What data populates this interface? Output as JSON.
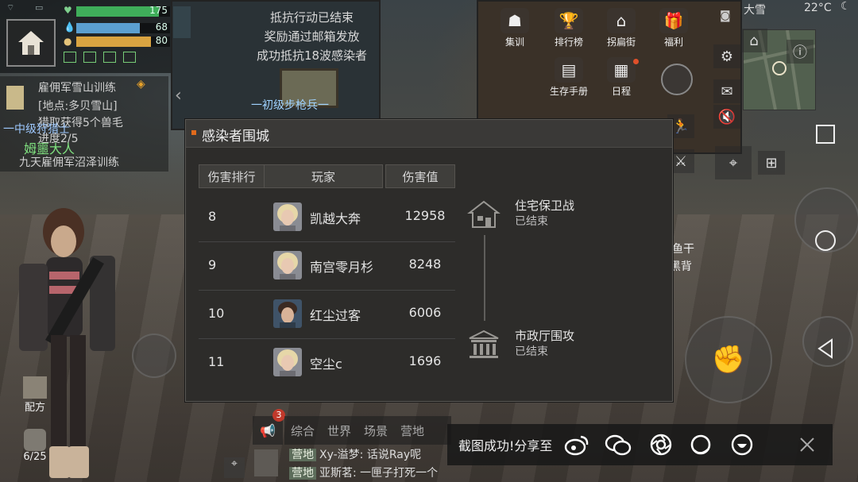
{
  "hud": {
    "hp_value": "175",
    "water_value": "68",
    "food_value": "80",
    "hp_fraction": 0.88,
    "water_fraction": 0.68,
    "food_fraction": 0.8
  },
  "quest": {
    "line1": "雇佣军雪山训练",
    "line2": "[地点:多贝雪山]",
    "line3": "猎取获得5个兽毛",
    "line4": "一中级狩猎士",
    "line5": "进度2/5",
    "line6": "姆噩大人",
    "line7": "九天雇佣军沼泽训练"
  },
  "notice": {
    "line1": "抵抗行动已结束",
    "line2": "奖励通过邮箱发放",
    "line3": "成功抵抗18波感染者"
  },
  "sign_text": "一初级步枪兵一",
  "top_menu": [
    {
      "label": "集训",
      "icon": "training-icon"
    },
    {
      "label": "排行榜",
      "icon": "trophy-icon"
    },
    {
      "label": "拐扁街",
      "icon": "market-icon"
    },
    {
      "label": "福利",
      "icon": "gift-icon"
    },
    {
      "label": "生存手册",
      "icon": "handbook-icon"
    },
    {
      "label": "日程",
      "icon": "calendar-icon"
    }
  ],
  "weather": {
    "text": "大雪",
    "temp": "22°C"
  },
  "dialog": {
    "title": "感染者围城",
    "headers": {
      "rank": "伤害排行",
      "player": "玩家",
      "damage": "伤害值"
    },
    "rows": [
      {
        "rank": "8",
        "name": "凯越大奔",
        "damage": "12958"
      },
      {
        "rank": "9",
        "name": "南宫零月杉",
        "damage": "8248"
      },
      {
        "rank": "10",
        "name": "红尘过客",
        "damage": "6006"
      },
      {
        "rank": "11",
        "name": "空尘c",
        "damage": "1696"
      }
    ],
    "stages": [
      {
        "name": "住宅保卫战",
        "status": "已结束"
      },
      {
        "name": "市政厅围攻",
        "status": "已结束"
      }
    ]
  },
  "npc_text": {
    "line1": "鱼干",
    "line2": "h的黑背"
  },
  "craft_label": "配方",
  "bag_count": "6/25",
  "chat": {
    "badge": "3",
    "tabs": [
      "综合",
      "世界",
      "场景",
      "营地"
    ],
    "line1_tag": "营地",
    "line1_text": "Xy-溢梦: 话说Ray呢",
    "line2_tag": "营地",
    "line2_text": "亚斯茗: 一匣子打死一个"
  },
  "share": {
    "text": "截图成功!分享至",
    "targets": [
      "weibo-icon",
      "wechat-icon",
      "moments-icon",
      "qzone-icon",
      "qq-icon"
    ]
  },
  "colors": {
    "accent": "#e06a1c",
    "dialog_bg": "#2d2c2a",
    "hp": "#3fae5a",
    "water": "#5b9fd0",
    "food": "#d9a441"
  }
}
